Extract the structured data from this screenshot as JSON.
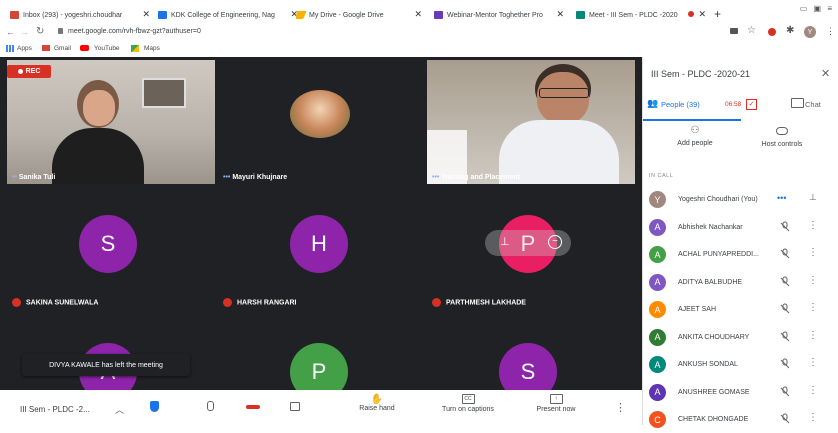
{
  "tabs": [
    {
      "label": "Inbox (293) - yogeshri.choudhar",
      "icon": "gmail-icon",
      "color": "#d44638"
    },
    {
      "label": "KDK College of Engineering, Nag",
      "icon": "site-icon",
      "color": "#1a73e8"
    },
    {
      "label": "My Drive - Google Drive",
      "icon": "drive-icon",
      "color": "#f4b400"
    },
    {
      "label": "Webinar-Mentor Toghether Pro",
      "icon": "forms-icon",
      "color": "#673ab7"
    },
    {
      "label": "Meet - III Sem - PLDC -2020",
      "icon": "meet-icon",
      "color": "#00897b"
    }
  ],
  "address": {
    "url": "meet.google.com/rvh-fbwz-gzt?authuser=0",
    "profile_initial": "Y"
  },
  "bookmarks": [
    {
      "label": "Apps",
      "icon": "apps-icon"
    },
    {
      "label": "Gmail",
      "icon": "gmail-icon"
    },
    {
      "label": "YouTube",
      "icon": "youtube-icon"
    },
    {
      "label": "Maps",
      "icon": "maps-icon"
    }
  ],
  "meet": {
    "rec_label": "REC",
    "tiles": [
      {
        "name": "Sanika Tuli",
        "kind": "video"
      },
      {
        "name": "Mayuri Khujnare",
        "kind": "photo"
      },
      {
        "name": "Training and Placement",
        "kind": "video"
      },
      {
        "name": "SAKINA SUNELWALA",
        "initial": "S",
        "color": "#8e24aa"
      },
      {
        "name": "HARSH RANGARI",
        "initial": "H",
        "color": "#8e24aa"
      },
      {
        "name": "PARTHMESH LAKHADE",
        "initial": "P",
        "color": "#e91e63"
      },
      {
        "name": "",
        "initial": "A",
        "color": "#8e24aa"
      },
      {
        "name": "",
        "initial": "P",
        "color": "#43a047"
      },
      {
        "name": "",
        "initial": "S",
        "color": "#8e24aa"
      }
    ],
    "toast": "DIVYA KAWALE has left the meeting",
    "tile_icons": {
      "pin": "pin-icon",
      "remove": "remove-icon"
    }
  },
  "bottom": {
    "meeting_title": "III Sem - PLDC -2...",
    "raise_hand": "Raise hand",
    "captions": "Turn on captions",
    "present": "Present now"
  },
  "side": {
    "title": "III Sem - PLDC -2020-21",
    "people_tab": "People (39)",
    "chat_tab": "Chat",
    "timer": "06:58",
    "add_people": "Add people",
    "host_controls": "Host controls",
    "in_call": "IN CALL",
    "participants": [
      {
        "initial": "Y",
        "name": "Yogeshri Choudhari (You)",
        "color": "#a1887f"
      },
      {
        "initial": "A",
        "name": "Abhishek Nachankar",
        "color": "#7e57c2"
      },
      {
        "initial": "A",
        "name": "ACHAL PUNYAPREDDI...",
        "color": "#43a047"
      },
      {
        "initial": "A",
        "name": "ADITYA BALBUDHE",
        "color": "#7e57c2"
      },
      {
        "initial": "A",
        "name": "AJEET SAH",
        "color": "#fb8c00"
      },
      {
        "initial": "A",
        "name": "ANKITA CHOUDHARY",
        "color": "#2e7d32"
      },
      {
        "initial": "A",
        "name": "ANKUSH SONDAL",
        "color": "#00897b"
      },
      {
        "initial": "A",
        "name": "ANUSHREE GOMASE",
        "color": "#5e35b1"
      },
      {
        "initial": "C",
        "name": "CHETAK DHONGADE",
        "color": "#f4511e"
      }
    ]
  }
}
